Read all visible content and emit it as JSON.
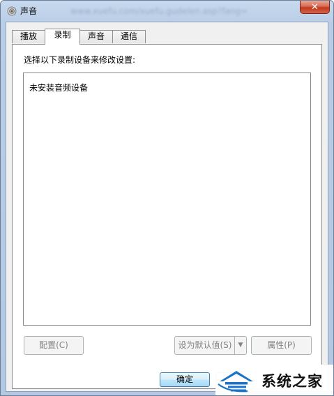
{
  "window": {
    "title": "声音",
    "blurred_url": "www.xuefu.com/xuefu.gudelen.asp?fang=",
    "close_label": "✕"
  },
  "tabs": [
    {
      "label": "播放"
    },
    {
      "label": "录制"
    },
    {
      "label": "声音"
    },
    {
      "label": "通信"
    }
  ],
  "recording": {
    "instruction": "选择以下录制设备来修改设置:",
    "empty_message": "未安装音频设备"
  },
  "buttons": {
    "configure": "配置(C)",
    "set_default": "设为默认值(S)",
    "properties": "属性(P)",
    "ok": "确定"
  },
  "watermark": {
    "text": "系统之家"
  },
  "colors": {
    "accent_blue": "#3c7fb1",
    "close_red": "#c2371d",
    "watermark_blue": "#1a73c8"
  }
}
